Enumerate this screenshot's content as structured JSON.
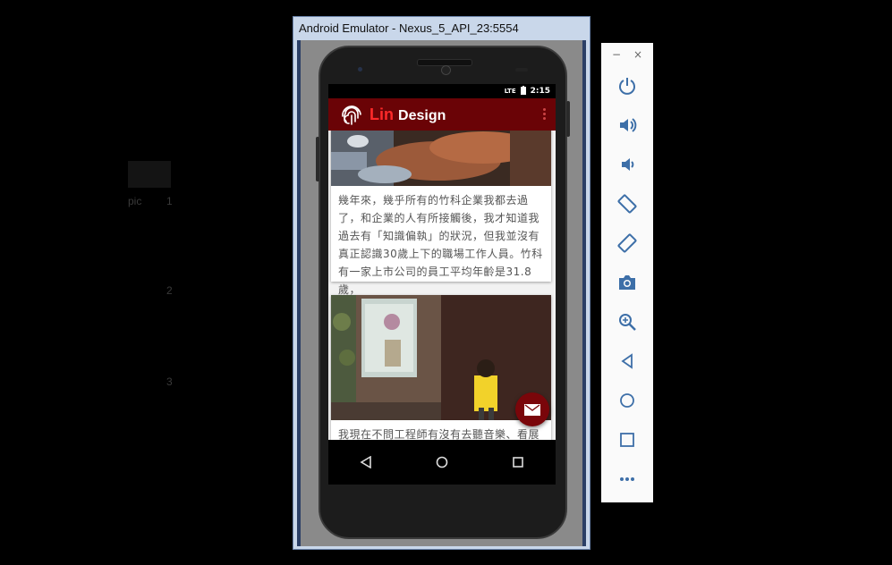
{
  "emulator": {
    "title": "Android Emulator - Nexus_5_API_23:5554"
  },
  "background": {
    "label_1": "pic",
    "label_2": "1",
    "label_3": "2",
    "label_4": "3"
  },
  "status_bar": {
    "time": "2:15",
    "network": "LTE"
  },
  "app_bar": {
    "title_part1": "Lin",
    "title_part2": "Design"
  },
  "cards": [
    {
      "text": "幾年來，幾乎所有的竹科企業我都去過了，和企業的人有所接觸後，我才知道我過去有「知識偏執」的狀況，但我並沒有真正認識30歲上下的職場工作人員。竹科有一家上市公司的員工平均年齡是31.8歲，"
    },
    {
      "text": "我現在不問工程師有沒有去聽音樂、看展"
    }
  ],
  "fab": {
    "icon": "mail-icon"
  },
  "nav": {
    "back": "back-icon",
    "home": "home-icon",
    "recents": "recents-icon"
  },
  "toolbar": {
    "minimize": "−",
    "close": "×",
    "items": [
      "power-icon",
      "volume-up-icon",
      "volume-down-icon",
      "rotate-left-icon",
      "rotate-right-icon",
      "camera-icon",
      "zoom-icon",
      "back-icon",
      "home-icon",
      "overview-icon",
      "more-icon"
    ]
  },
  "colors": {
    "app_bar": "#6a0306",
    "accent_red": "#ff2a2a",
    "fab": "#7a060a"
  }
}
